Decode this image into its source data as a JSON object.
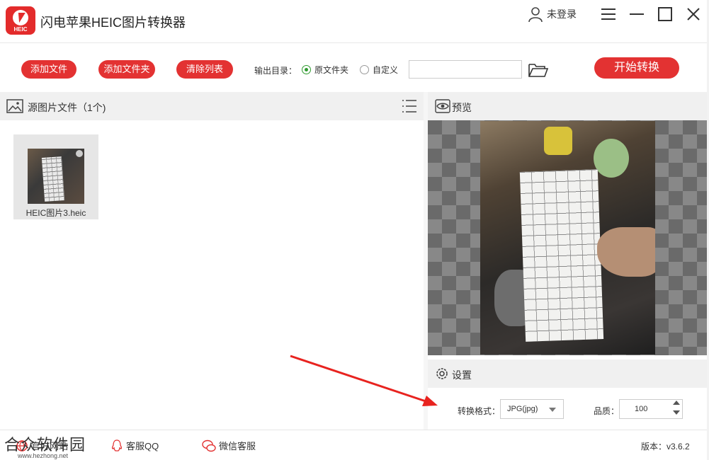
{
  "app": {
    "title": "闪电苹果HEIC图片转换器",
    "logo_text": "HEIC",
    "login_label": "未登录"
  },
  "toolbar": {
    "add_file": "添加文件",
    "add_folder": "添加文件夹",
    "clear_list": "清除列表",
    "output_label": "输出目录：",
    "radio_original": "原文件夹",
    "radio_custom": "自定义",
    "selected_output": "原文件夹",
    "path_value": "",
    "start": "开始转换"
  },
  "source_panel": {
    "title": "源图片文件（1个)",
    "files": [
      {
        "name": "HEIC图片3.heic"
      }
    ]
  },
  "preview": {
    "title": "预览"
  },
  "settings": {
    "title": "设置",
    "format_label": "转换格式：",
    "format_value": "JPG(jpg)",
    "quality_label": "品质：",
    "quality_value": "100"
  },
  "footer": {
    "website": "官方网站",
    "qq": "客服QQ",
    "wechat": "微信客服",
    "version": "版本：v3.6.2"
  },
  "watermark": {
    "name": "合众软件园",
    "url": "www.hezhong.net"
  },
  "colors": {
    "accent": "#e33232",
    "radio_on": "#2e9a2e",
    "arrow": "#e8231f"
  }
}
